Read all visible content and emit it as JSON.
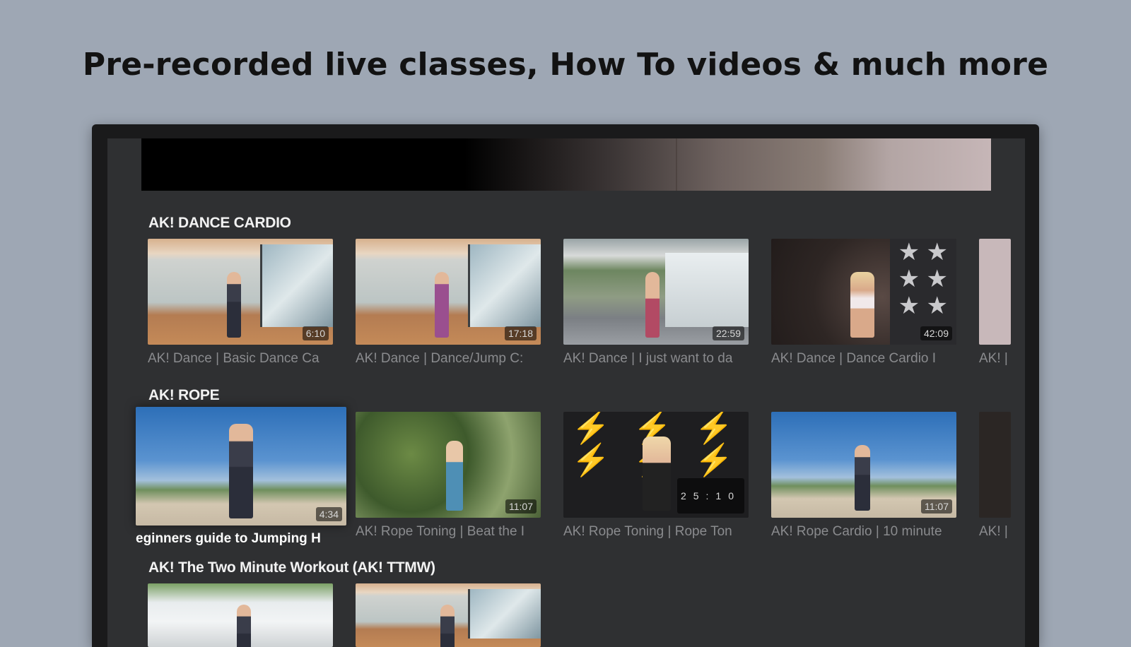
{
  "headline": "Pre-recorded live classes, How To videos & much more",
  "rows": [
    {
      "title": "AK! DANCE CARDIO",
      "tiles": [
        {
          "caption": "AK! Dance | Basic Dance Ca",
          "duration": "6:10"
        },
        {
          "caption": "AK! Dance | Dance/Jump C:",
          "duration": "17:18"
        },
        {
          "caption": "AK! Dance | I just want to da",
          "duration": "22:59"
        },
        {
          "caption": "AK! Dance | Dance Cardio I",
          "duration": "42:09"
        }
      ],
      "peek_caption": "AK! |"
    },
    {
      "title": "AK! ROPE",
      "tiles": [
        {
          "caption": "eginners guide to Jumping     H",
          "duration": "4:34"
        },
        {
          "caption": "AK! Rope Toning | Beat the I",
          "duration": "11:07"
        },
        {
          "caption": "AK! Rope Toning  | Rope Ton",
          "duration": "25:10"
        },
        {
          "caption": "AK! Rope Cardio | 10 minute",
          "duration": "11:07"
        }
      ],
      "peek_caption": "AK! |"
    },
    {
      "title": "AK! The Two Minute Workout  (AK! TTMW)",
      "tiles": []
    }
  ],
  "icons": {
    "stars": "star-pattern",
    "bolts": "lightning-pattern"
  }
}
